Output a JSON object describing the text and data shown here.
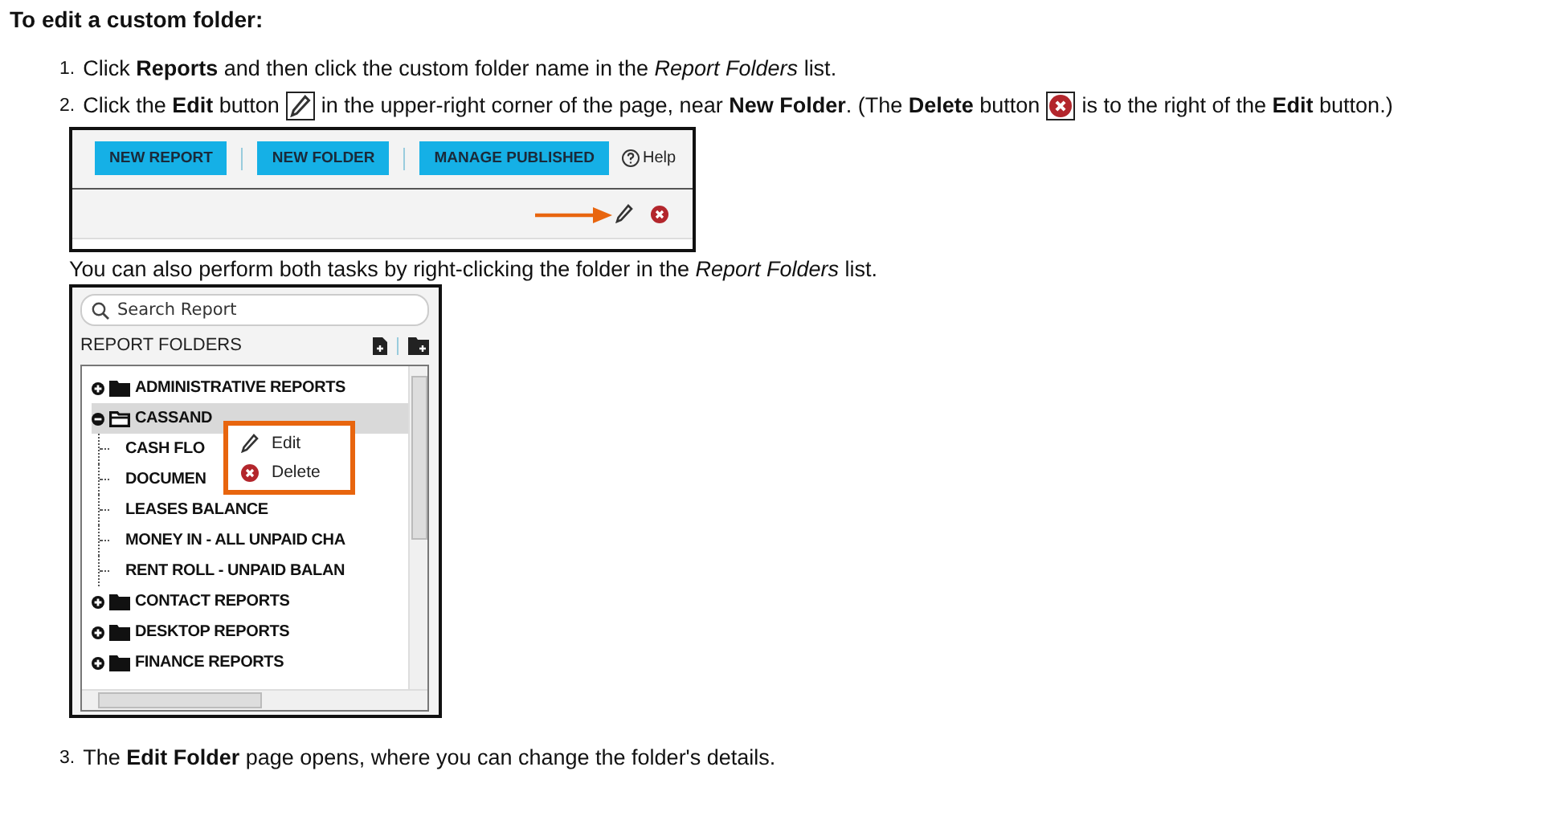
{
  "heading": "To edit a custom folder:",
  "steps_before": [
    {
      "number": "1.",
      "segments": [
        {
          "kind": "text",
          "text": "Click **Reports** and then click the custom folder name in the *Report Folders* list."
        }
      ]
    },
    {
      "number": "2.",
      "segments": [
        {
          "kind": "text",
          "text": "Click the **Edit** button"
        },
        {
          "kind": "pencil"
        },
        {
          "kind": "text",
          "text": "in the upper-right corner of the page, near **New Folder**. (The **Delete** button"
        },
        {
          "kind": "delete"
        },
        {
          "kind": "text",
          "text": "is to the right of the **Edit** button.)"
        }
      ]
    }
  ],
  "toolbar_figure": {
    "buttons": [
      "NEW REPORT",
      "NEW FOLDER",
      "MANAGE PUBLISHED"
    ],
    "help": "Help"
  },
  "note": "You can also perform both tasks by right-clicking the folder in the *Report Folders* list.",
  "folders_figure": {
    "search": {
      "placeholder": "Search Report"
    },
    "header": "REPORT FOLDERS",
    "tree": [
      {
        "label": "ADMINISTRATIVE REPORTS",
        "expanded": false,
        "selected": false
      },
      {
        "label": "CASSAND",
        "expanded": true,
        "selected": true,
        "children": [
          {
            "label": "CASH FLO",
            "selected": false
          },
          {
            "label": "DOCUMEN",
            "selected": false
          },
          {
            "label": "LEASES BALANCE",
            "selected": false
          },
          {
            "label": "MONEY IN - ALL UNPAID CHA",
            "selected": false
          },
          {
            "label": "RENT ROLL - UNPAID BALAN",
            "selected": false
          }
        ]
      },
      {
        "label": "CONTACT REPORTS",
        "expanded": false,
        "selected": false
      },
      {
        "label": "DESKTOP REPORTS",
        "expanded": false,
        "selected": false
      },
      {
        "label": "FINANCE REPORTS",
        "expanded": false,
        "selected": false
      }
    ],
    "context_menu": [
      {
        "kind": "edit",
        "label": "Edit"
      },
      {
        "kind": "delete",
        "label": "Delete"
      }
    ]
  },
  "steps_after": [
    {
      "number": "3.",
      "segments": [
        {
          "kind": "text",
          "text": "The **Edit Folder** page opens, where you can change the folder's details."
        }
      ]
    }
  ]
}
